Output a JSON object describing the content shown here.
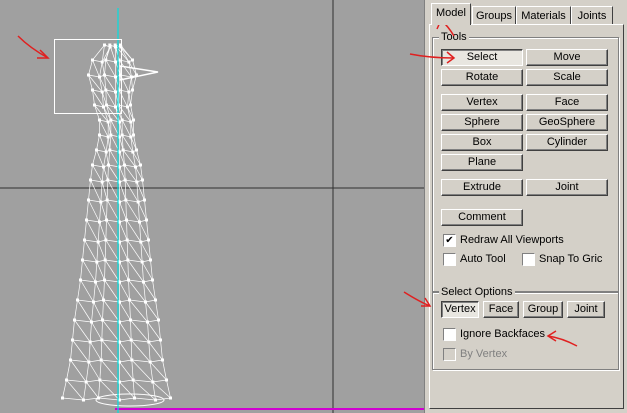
{
  "tabs": [
    {
      "label": "Model",
      "active": true
    },
    {
      "label": "Groups",
      "active": false
    },
    {
      "label": "Materials",
      "active": false
    },
    {
      "label": "Joints",
      "active": false
    }
  ],
  "tools": {
    "group_label": "Tools",
    "buttons": [
      "Select",
      "Move",
      "Rotate",
      "Scale",
      "Vertex",
      "Face",
      "Sphere",
      "GeoSphere",
      "Box",
      "Cylinder",
      "Plane",
      "Extrude",
      "Joint",
      "Comment"
    ],
    "selected": "Select",
    "checkboxes": [
      {
        "label": "Redraw All Viewports",
        "checked": true
      },
      {
        "label": "Auto Tool",
        "checked": false
      },
      {
        "label": "Snap To Gric",
        "checked": false
      }
    ]
  },
  "select_options": {
    "group_label": "Select Options",
    "buttons": [
      "Vertex",
      "Face",
      "Group",
      "Joint"
    ],
    "selected": "Vertex",
    "ignore_backfaces": {
      "label": "Ignore Backfaces",
      "checked": false
    },
    "by_vertex": {
      "label": "By Vertex",
      "checked": false,
      "disabled": true
    }
  },
  "colors": {
    "viewport_bg": "#a0a0a0",
    "axis": "#00e0e0",
    "mesh": "#ffffff",
    "annotation": "#e02020",
    "panel_bg": "#d4d0c8"
  }
}
